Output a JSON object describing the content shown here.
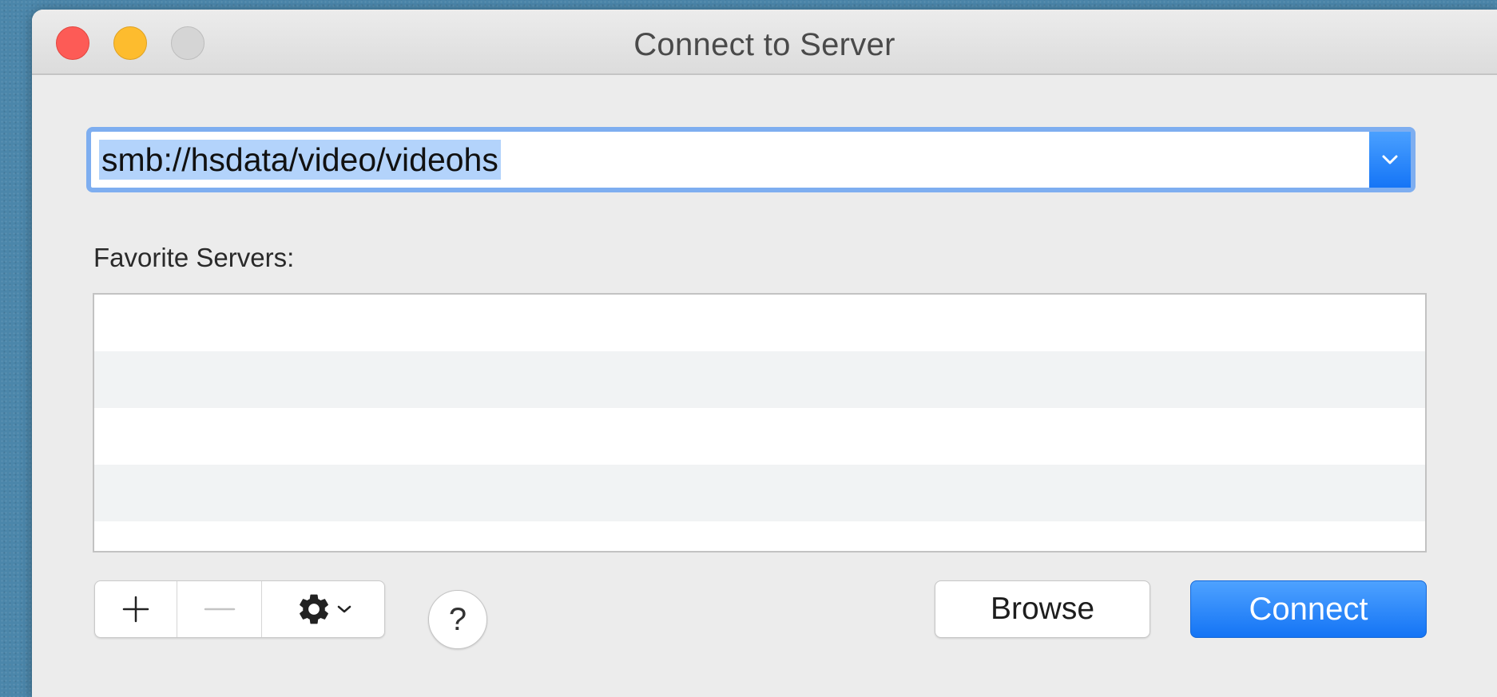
{
  "window": {
    "title": "Connect to Server"
  },
  "server_address": {
    "value": "smb://hsdata/video/videohs"
  },
  "favorites": {
    "label": "Favorite Servers:",
    "items": []
  },
  "toolbar": {
    "add_label": "+",
    "remove_label": "—",
    "gear_icon": "gear-icon",
    "help_label": "?"
  },
  "buttons": {
    "browse_label": "Browse",
    "connect_label": "Connect"
  },
  "colors": {
    "accent": "#1a7cf7",
    "close": "#fd5b56",
    "minimize": "#fdbc2e",
    "zoom_disabled": "#d5d5d5",
    "selection": "#b3d3fb"
  }
}
